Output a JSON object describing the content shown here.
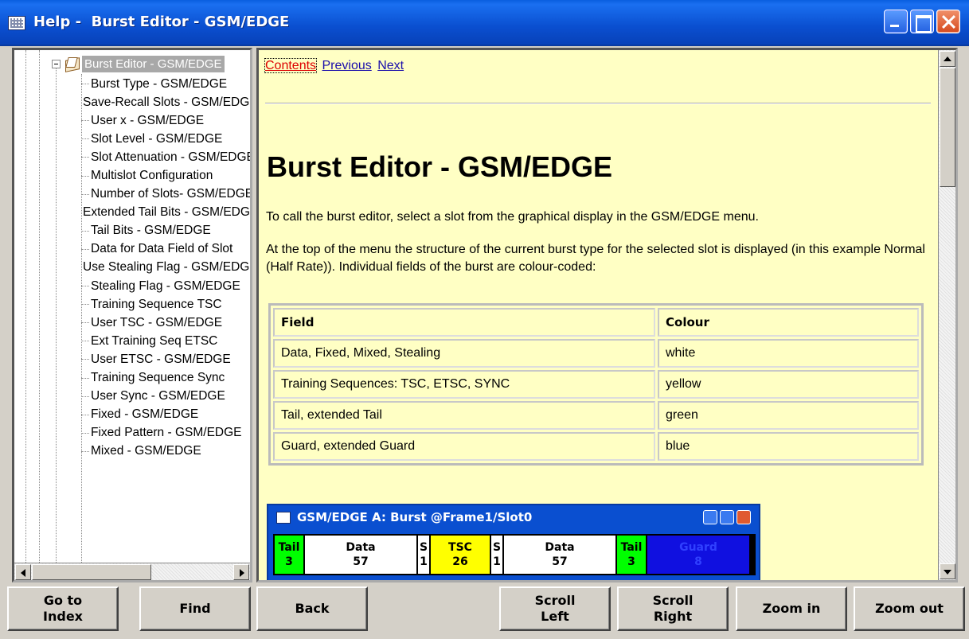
{
  "window": {
    "title": "Help -  Burst Editor - GSM/EDGE"
  },
  "tree": {
    "root_label": "Burst Editor - GSM/EDGE",
    "items": [
      "Burst Type - GSM/EDGE",
      "Save-Recall Slots - GSM/EDGE",
      "User x - GSM/EDGE",
      "Slot Level - GSM/EDGE",
      "Slot Attenuation - GSM/EDGE",
      "Multislot Configuration",
      "Number of Slots- GSM/EDGE",
      "Extended Tail Bits - GSM/EDGE",
      "Tail Bits - GSM/EDGE",
      "Data for Data Field of Slot",
      "Use Stealing Flag - GSM/EDGE",
      "Stealing Flag - GSM/EDGE",
      "Training Sequence TSC",
      "User TSC - GSM/EDGE",
      "Ext Training Seq ETSC",
      "User ETSC - GSM/EDGE",
      "Training Sequence Sync",
      "User Sync - GSM/EDGE",
      "Fixed - GSM/EDGE",
      "Fixed Pattern - GSM/EDGE",
      "Mixed - GSM/EDGE"
    ]
  },
  "content": {
    "nav": {
      "contents": "Contents",
      "previous": "Previous",
      "next": "Next"
    },
    "heading": "Burst Editor - GSM/EDGE",
    "para1": "To call the burst editor, select a slot from the graphical display in the GSM/EDGE menu.",
    "para2": "At the top of the menu the structure of the current burst type for the selected slot is displayed (in this example Normal (Half Rate)). Individual fields of the burst are colour-coded:",
    "table": {
      "headers": [
        "Field",
        "Colour"
      ],
      "rows": [
        [
          "Data, Fixed, Mixed, Stealing",
          "white"
        ],
        [
          "Training Sequences: TSC, ETSC, SYNC",
          "yellow"
        ],
        [
          "Tail, extended Tail",
          "green"
        ],
        [
          "Guard, extended Guard",
          "blue"
        ]
      ]
    },
    "mini_window": {
      "title": "GSM/EDGE A: Burst @Frame1/Slot0",
      "fields": [
        {
          "name": "Tail",
          "bits": "3",
          "color": "#00ff00"
        },
        {
          "name": "Data",
          "bits": "57",
          "color": "#ffffff"
        },
        {
          "name": "S",
          "bits": "1",
          "color": "#ffffff"
        },
        {
          "name": "TSC",
          "bits": "26",
          "color": "#ffff00"
        },
        {
          "name": "S",
          "bits": "1",
          "color": "#ffffff"
        },
        {
          "name": "Data",
          "bits": "57",
          "color": "#ffffff"
        },
        {
          "name": "Tail",
          "bits": "3",
          "color": "#00ff00"
        },
        {
          "name": "Guard",
          "bits": "8",
          "color": "#1010e0"
        }
      ]
    }
  },
  "buttons": {
    "go_to_index": "Go to\nIndex",
    "find": "Find",
    "back": "Back",
    "scroll_left": "Scroll\nLeft",
    "scroll_right": "Scroll\nRight",
    "zoom_in": "Zoom in",
    "zoom_out": "Zoom out"
  },
  "colors": {
    "titlebar": "#0a4fd0",
    "content_background": "#ffffc4",
    "link": "#1a0dab",
    "current_link": "#dd0000"
  }
}
